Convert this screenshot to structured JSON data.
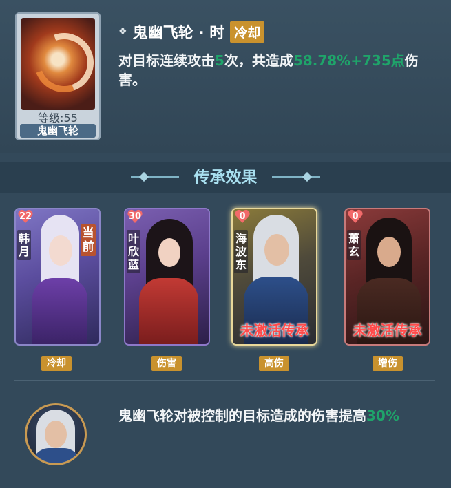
{
  "skill": {
    "level_label": "等级:55",
    "card_name": "鬼幽飞轮",
    "title": "鬼幽飞轮 · 时",
    "badge": "冷却",
    "desc_prefix": "对目标连续攻击",
    "desc_hits": "5",
    "desc_mid": "次，共造成",
    "desc_value": "58.78%+735点",
    "desc_suffix": "伤害。"
  },
  "section": {
    "title": "传承效果"
  },
  "heroes": [
    {
      "name": "韩月",
      "count": "22",
      "current_label": "当前",
      "tag": "冷却",
      "inactive_label": ""
    },
    {
      "name": "叶欣蓝",
      "count": "30",
      "current_label": "",
      "tag": "伤害",
      "inactive_label": ""
    },
    {
      "name": "海波东",
      "count": "0",
      "current_label": "",
      "tag": "高伤",
      "inactive_label": "未激活传承"
    },
    {
      "name": "萧玄",
      "count": "0",
      "current_label": "",
      "tag": "增伤",
      "inactive_label": "未激活传承"
    }
  ],
  "bonus": {
    "text_prefix": "鬼幽飞轮对被控制的目标造成的伤害提高",
    "text_value": "30%"
  },
  "colors": {
    "accent_gold": "#c9922e",
    "highlight_green": "#1fa46a",
    "inactive_red": "#ff4b4b"
  },
  "icons": {
    "bullet": "diamond-icon",
    "heart": "heart-icon"
  }
}
